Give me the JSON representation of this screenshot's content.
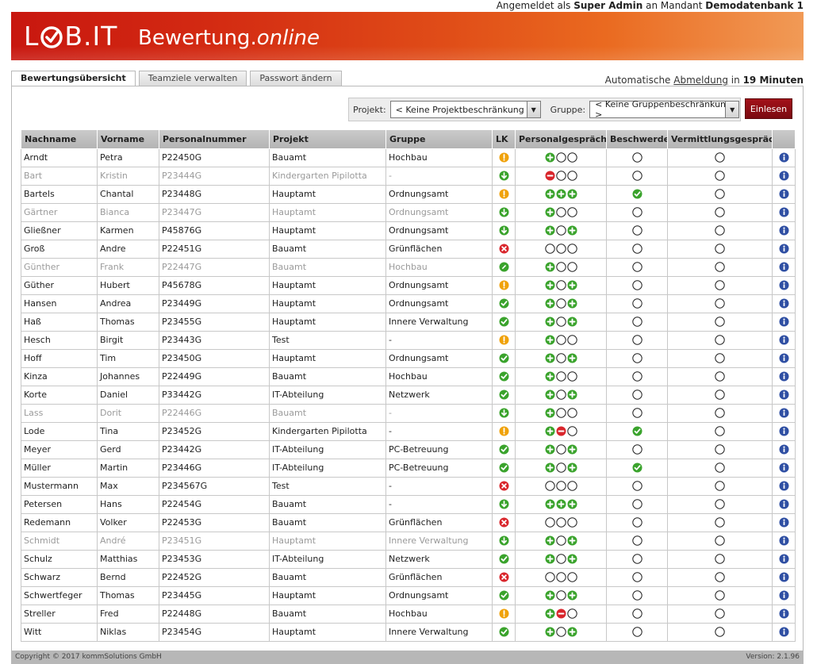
{
  "login": {
    "prefix": "Angemeldet als",
    "user": "Super Admin",
    "middle": "an Mandant",
    "tenant": "Demodatenbank 1"
  },
  "brand": {
    "logo_left": "L",
    "logo_right": "B.IT",
    "app_name": "Bewertung.",
    "app_name_italic": "online"
  },
  "tabs": [
    {
      "label": "Bewertungsübersicht"
    },
    {
      "label": "Teamziele verwalten"
    },
    {
      "label": "Passwort ändern"
    }
  ],
  "session": {
    "prefix": "Automatische",
    "link": "Abmeldung",
    "middle": "in",
    "time": "19 Minuten"
  },
  "filters": {
    "project_label": "Projekt:",
    "project_value": "< Keine Projektbeschränkung >",
    "group_label": "Gruppe:",
    "group_value": "< Keine Gruppenbeschränkung >",
    "read_button": "Einlesen"
  },
  "table": {
    "headers": [
      "Nachname",
      "Vorname",
      "Personalnummer",
      "Projekt",
      "Gruppe",
      "LK",
      "Personalgespräche",
      "Beschwerde",
      "Vermittlungsgespräch",
      ""
    ],
    "rows": [
      {
        "nachname": "Arndt",
        "vorname": "Petra",
        "nr": "P22450G",
        "projekt": "Bauamt",
        "gruppe": "Hochbau",
        "inactive": false,
        "lk": "warn",
        "pg": [
          "plus",
          "empty",
          "empty"
        ],
        "beschwerde": "empty"
      },
      {
        "nachname": "Bart",
        "vorname": "Kristin",
        "nr": "P23444G",
        "projekt": "Kindergarten Pipilotta",
        "gruppe": "-",
        "inactive": true,
        "lk": "down",
        "pg": [
          "minus",
          "empty",
          "empty"
        ],
        "beschwerde": "empty"
      },
      {
        "nachname": "Bartels",
        "vorname": "Chantal",
        "nr": "P23448G",
        "projekt": "Hauptamt",
        "gruppe": "Ordnungsamt",
        "inactive": false,
        "lk": "warn",
        "pg": [
          "plus",
          "plus",
          "plus"
        ],
        "beschwerde": "check"
      },
      {
        "nachname": "Gärtner",
        "vorname": "Bianca",
        "nr": "P23447G",
        "projekt": "Hauptamt",
        "gruppe": "Ordnungsamt",
        "inactive": true,
        "lk": "down",
        "pg": [
          "plus",
          "empty",
          "empty"
        ],
        "beschwerde": "empty"
      },
      {
        "nachname": "Gließner",
        "vorname": "Karmen",
        "nr": "P45876G",
        "projekt": "Hauptamt",
        "gruppe": "Ordnungsamt",
        "inactive": false,
        "lk": "down",
        "pg": [
          "plus",
          "empty",
          "plus"
        ],
        "beschwerde": "empty"
      },
      {
        "nachname": "Groß",
        "vorname": "Andre",
        "nr": "P22451G",
        "projekt": "Bauamt",
        "gruppe": "Grünflächen",
        "inactive": false,
        "lk": "x",
        "pg": [
          "empty",
          "empty",
          "empty"
        ],
        "beschwerde": "empty"
      },
      {
        "nachname": "Günther",
        "vorname": "Frank",
        "nr": "P22447G",
        "projekt": "Bauamt",
        "gruppe": "Hochbau",
        "inactive": true,
        "lk": "pencil",
        "pg": [
          "plus",
          "empty",
          "empty"
        ],
        "beschwerde": "empty"
      },
      {
        "nachname": "Güther",
        "vorname": "Hubert",
        "nr": "P45678G",
        "projekt": "Hauptamt",
        "gruppe": "Ordnungsamt",
        "inactive": false,
        "lk": "warn",
        "pg": [
          "plus",
          "empty",
          "plus"
        ],
        "beschwerde": "empty"
      },
      {
        "nachname": "Hansen",
        "vorname": "Andrea",
        "nr": "P23449G",
        "projekt": "Hauptamt",
        "gruppe": "Ordnungsamt",
        "inactive": false,
        "lk": "check",
        "pg": [
          "plus",
          "empty",
          "plus"
        ],
        "beschwerde": "empty"
      },
      {
        "nachname": "Haß",
        "vorname": "Thomas",
        "nr": "P23455G",
        "projekt": "Hauptamt",
        "gruppe": "Innere Verwaltung",
        "inactive": false,
        "lk": "check",
        "pg": [
          "plus",
          "empty",
          "plus"
        ],
        "beschwerde": "empty"
      },
      {
        "nachname": "Hesch",
        "vorname": "Birgit",
        "nr": "P23443G",
        "projekt": "Test",
        "gruppe": "-",
        "inactive": false,
        "lk": "warn",
        "pg": [
          "plus",
          "empty",
          "empty"
        ],
        "beschwerde": "empty"
      },
      {
        "nachname": "Hoff",
        "vorname": "Tim",
        "nr": "P23450G",
        "projekt": "Hauptamt",
        "gruppe": "Ordnungsamt",
        "inactive": false,
        "lk": "check",
        "pg": [
          "plus",
          "empty",
          "plus"
        ],
        "beschwerde": "empty"
      },
      {
        "nachname": "Kinza",
        "vorname": "Johannes",
        "nr": "P22449G",
        "projekt": "Bauamt",
        "gruppe": "Hochbau",
        "inactive": false,
        "lk": "check",
        "pg": [
          "plus",
          "empty",
          "empty"
        ],
        "beschwerde": "empty"
      },
      {
        "nachname": "Korte",
        "vorname": "Daniel",
        "nr": "P33442G",
        "projekt": "IT-Abteilung",
        "gruppe": "Netzwerk",
        "inactive": false,
        "lk": "check",
        "pg": [
          "plus",
          "empty",
          "plus"
        ],
        "beschwerde": "empty"
      },
      {
        "nachname": "Lass",
        "vorname": "Dorit",
        "nr": "P22446G",
        "projekt": "Bauamt",
        "gruppe": "-",
        "inactive": true,
        "lk": "down",
        "pg": [
          "plus",
          "empty",
          "empty"
        ],
        "beschwerde": "empty"
      },
      {
        "nachname": "Lode",
        "vorname": "Tina",
        "nr": "P23452G",
        "projekt": "Kindergarten Pipilotta",
        "gruppe": "-",
        "inactive": false,
        "lk": "warn",
        "pg": [
          "plus",
          "minus",
          "empty"
        ],
        "beschwerde": "check"
      },
      {
        "nachname": "Meyer",
        "vorname": "Gerd",
        "nr": "P23442G",
        "projekt": "IT-Abteilung",
        "gruppe": "PC-Betreuung",
        "inactive": false,
        "lk": "check",
        "pg": [
          "plus",
          "empty",
          "plus"
        ],
        "beschwerde": "empty"
      },
      {
        "nachname": "Müller",
        "vorname": "Martin",
        "nr": "P23446G",
        "projekt": "IT-Abteilung",
        "gruppe": "PC-Betreuung",
        "inactive": false,
        "lk": "check",
        "pg": [
          "plus",
          "empty",
          "plus"
        ],
        "beschwerde": "check"
      },
      {
        "nachname": "Mustermann",
        "vorname": "Max",
        "nr": "P234567G",
        "projekt": "Test",
        "gruppe": "-",
        "inactive": false,
        "lk": "x",
        "pg": [
          "empty",
          "empty",
          "empty"
        ],
        "beschwerde": "empty"
      },
      {
        "nachname": "Petersen",
        "vorname": "Hans",
        "nr": "P22454G",
        "projekt": "Bauamt",
        "gruppe": "-",
        "inactive": false,
        "lk": "down",
        "pg": [
          "plus",
          "plus",
          "plus"
        ],
        "beschwerde": "empty"
      },
      {
        "nachname": "Redemann",
        "vorname": "Volker",
        "nr": "P22453G",
        "projekt": "Bauamt",
        "gruppe": "Grünflächen",
        "inactive": false,
        "lk": "x",
        "pg": [
          "empty",
          "empty",
          "empty"
        ],
        "beschwerde": "empty"
      },
      {
        "nachname": "Schmidt",
        "vorname": "André",
        "nr": "P23451G",
        "projekt": "Hauptamt",
        "gruppe": "Innere Verwaltung",
        "inactive": true,
        "lk": "down",
        "pg": [
          "plus",
          "empty",
          "plus"
        ],
        "beschwerde": "empty"
      },
      {
        "nachname": "Schulz",
        "vorname": "Matthias",
        "nr": "P23453G",
        "projekt": "IT-Abteilung",
        "gruppe": "Netzwerk",
        "inactive": false,
        "lk": "check",
        "pg": [
          "plus",
          "empty",
          "plus"
        ],
        "beschwerde": "empty"
      },
      {
        "nachname": "Schwarz",
        "vorname": "Bernd",
        "nr": "P22452G",
        "projekt": "Bauamt",
        "gruppe": "Grünflächen",
        "inactive": false,
        "lk": "x",
        "pg": [
          "empty",
          "empty",
          "empty"
        ],
        "beschwerde": "empty"
      },
      {
        "nachname": "Schwertfeger",
        "vorname": "Thomas",
        "nr": "P23445G",
        "projekt": "Hauptamt",
        "gruppe": "Ordnungsamt",
        "inactive": false,
        "lk": "check",
        "pg": [
          "plus",
          "empty",
          "plus"
        ],
        "beschwerde": "empty"
      },
      {
        "nachname": "Streller",
        "vorname": "Fred",
        "nr": "P22448G",
        "projekt": "Bauamt",
        "gruppe": "Hochbau",
        "inactive": false,
        "lk": "warn",
        "pg": [
          "plus",
          "minus",
          "empty"
        ],
        "beschwerde": "empty"
      },
      {
        "nachname": "Witt",
        "vorname": "Niklas",
        "nr": "P23454G",
        "projekt": "Hauptamt",
        "gruppe": "Innere Verwaltung",
        "inactive": false,
        "lk": "check",
        "pg": [
          "plus",
          "empty",
          "plus"
        ],
        "beschwerde": "empty"
      }
    ]
  },
  "icons": {
    "warn": "warning-icon",
    "down": "arrow-down-icon",
    "check": "check-icon",
    "x": "error-icon",
    "pencil": "pencil-icon",
    "plus": "plus-icon",
    "minus": "minus-icon",
    "empty": "empty-circle-icon",
    "info": "info-icon"
  },
  "colors": {
    "green": "#3aa32c",
    "red": "#d9262c",
    "amber": "#f0a20a",
    "blue": "#2f4fa3",
    "brand_red": "#c8170f",
    "button_red": "#8d0d14"
  },
  "footer": {
    "copyright": "Copyright © 2017 kommSolutions GmbH",
    "version": "Version: 2.1.96"
  }
}
